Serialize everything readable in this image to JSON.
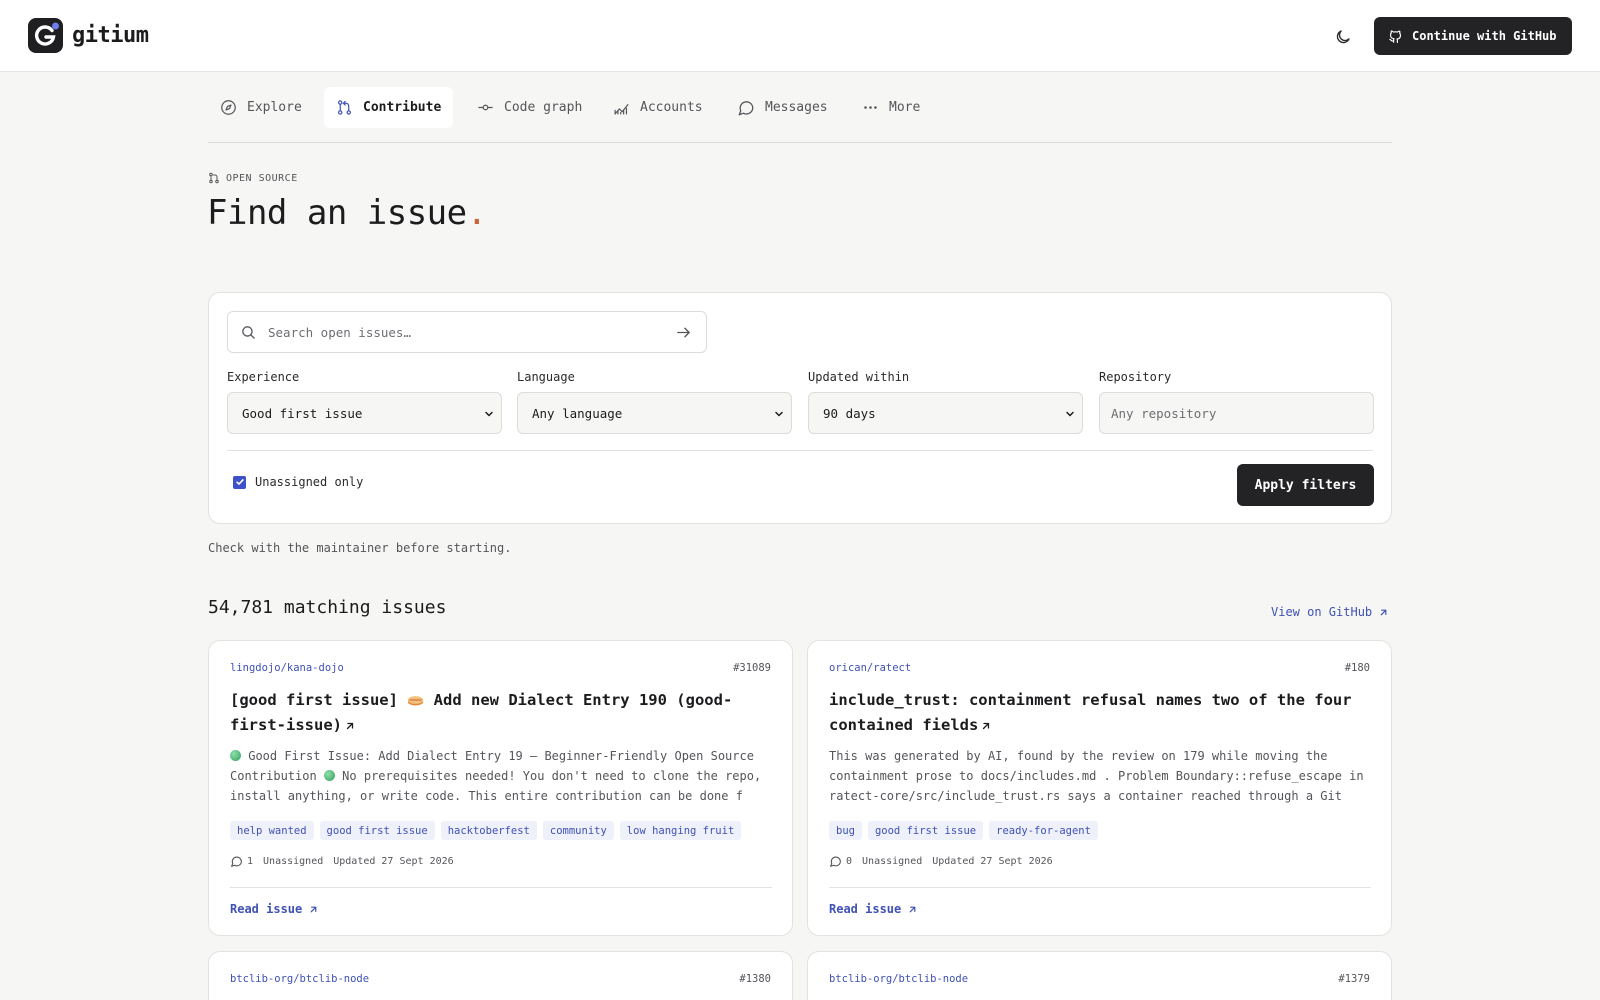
{
  "app": {
    "name": "gitium"
  },
  "header": {
    "cta_label": "Continue with GitHub"
  },
  "nav": {
    "items": [
      {
        "label": "Explore",
        "icon": "compass-icon"
      },
      {
        "label": "Contribute",
        "icon": "git-pull-request-icon",
        "active": true
      },
      {
        "label": "Code graph",
        "icon": "git-commit-icon"
      },
      {
        "label": "Accounts",
        "icon": "chart-line-icon"
      },
      {
        "label": "Messages",
        "icon": "message-circle-icon"
      },
      {
        "label": "More",
        "icon": "more-horizontal-icon"
      }
    ]
  },
  "page": {
    "kicker": "OPEN SOURCE",
    "title": "Find an issue",
    "title_dot": ".",
    "accent_color": "#c8643c"
  },
  "filters": {
    "search_placeholder": "Search open issues…",
    "experience": {
      "label": "Experience",
      "value": "Good first issue"
    },
    "language": {
      "label": "Language",
      "value": "Any language"
    },
    "updated": {
      "label": "Updated within",
      "value": "90 days"
    },
    "repository": {
      "label": "Repository",
      "placeholder": "Any repository"
    },
    "unassigned_label": "Unassigned only",
    "unassigned_checked": true,
    "apply_label": "Apply filters"
  },
  "note": "Check with the maintainer before starting.",
  "results": {
    "count_text": "54,781 matching issues",
    "view_on_github": "View on GitHub"
  },
  "issues": [
    {
      "repo": "lingdojo/kana-dojo",
      "number": "#31089",
      "title_prefix": "[good first issue]",
      "title_suffix": "Add new Dialect Entry 190 (good-first-issue)",
      "desc_1": "Good First Issue: Add Dialect Entry 19 — Beginner-Friendly Open Source Contribution",
      "desc_2": "No prerequisites needed! You don't need to clone the repo, install anything, or write code. This entire contribution can be done f",
      "tags": [
        "help wanted",
        "good first issue",
        "hacktoberfest",
        "community",
        "low hanging fruit"
      ],
      "comments": "1",
      "assignee": "Unassigned",
      "updated": "Updated 27 Sept 2026",
      "read_label": "Read issue"
    },
    {
      "repo": "orican/ratect",
      "number": "#180",
      "title": "include_trust: containment refusal names two of the four contained fields",
      "desc": "This was generated by AI, found by the review on 179 while moving the containment prose to docs/includes.md . Problem Boundary::refuse_escape in ratect-core/src/include_trust.rs says a container reached through a Git inc",
      "tags": [
        "bug",
        "good first issue",
        "ready-for-agent"
      ],
      "comments": "0",
      "assignee": "Unassigned",
      "updated": "Updated 27 Sept 2026",
      "read_label": "Read issue"
    },
    {
      "repo": "btclib-org/btclib-node",
      "number": "#1380"
    },
    {
      "repo": "btclib-org/btclib-node",
      "number": "#1379"
    }
  ]
}
